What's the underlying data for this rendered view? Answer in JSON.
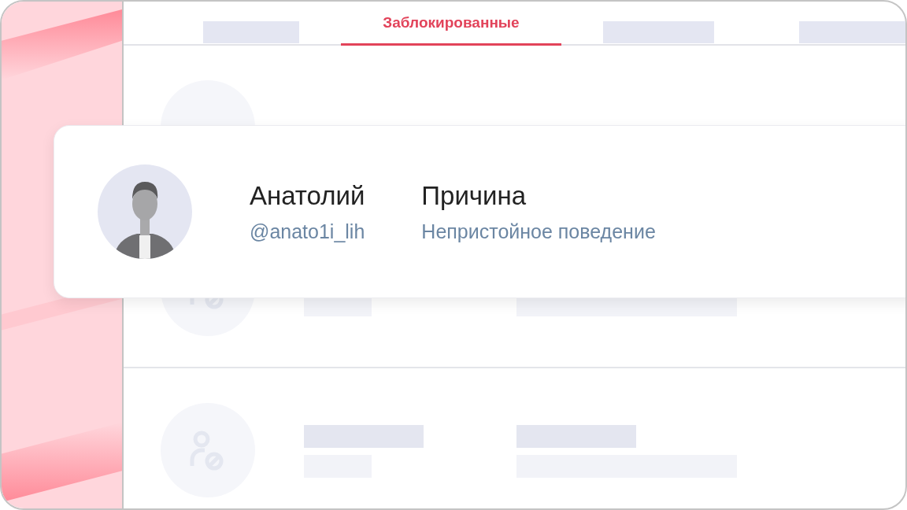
{
  "tabs": [
    {
      "kind": "placeholder",
      "selected": false
    },
    {
      "kind": "label",
      "label": "Заблокированные",
      "selected": true
    },
    {
      "kind": "placeholder",
      "selected": false
    },
    {
      "kind": "placeholder",
      "selected": false
    }
  ],
  "rows": [
    {
      "kind": "covered"
    },
    {
      "kind": "placeholder"
    },
    {
      "kind": "placeholder"
    }
  ],
  "card": {
    "name": "Анатолий",
    "handle": "@anato1i_lih",
    "reason_label": "Причина",
    "reason": "Непристойное поведение"
  }
}
